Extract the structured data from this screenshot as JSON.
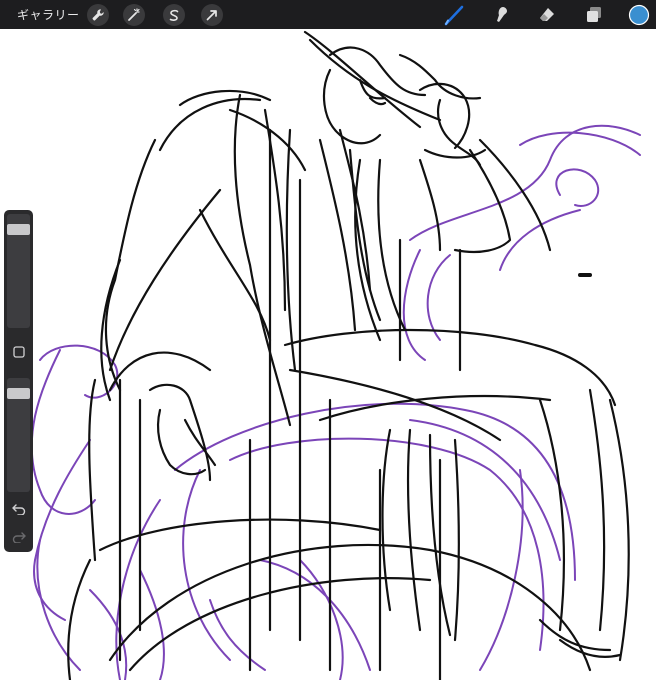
{
  "topbar": {
    "gallery_label": "ギャラリー",
    "left_tools": [
      "wrench-icon",
      "magic-wand-icon",
      "selection-icon",
      "transform-arrow-icon"
    ],
    "right_tools": [
      "brush-icon",
      "smudge-icon",
      "eraser-icon",
      "layers-icon",
      "color-swatch"
    ],
    "active_tool": "brush-icon",
    "brush_color": "#1e6fe0",
    "swatch_color": "#3a8fd0"
  },
  "sidebar": {
    "brush_size_level": 0.9,
    "opacity_level": 0.9,
    "buttons": [
      "square-modify-icon",
      "undo-icon",
      "redo-icon"
    ]
  },
  "canvas": {
    "ink_color": "#111111",
    "sketch_color": "#7b45b8"
  }
}
